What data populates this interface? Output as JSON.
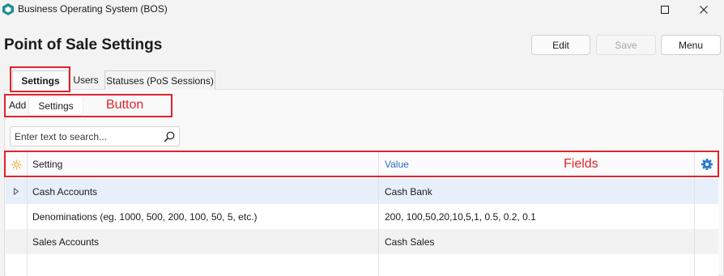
{
  "window": {
    "title": "Business Operating System (BOS)"
  },
  "page": {
    "title": "Point of Sale Settings"
  },
  "header_buttons": {
    "edit": "Edit",
    "save": "Save",
    "menu": "Menu"
  },
  "tabs": [
    {
      "label": "Settings"
    },
    {
      "label": "Users"
    },
    {
      "label": "Statuses (PoS Sessions)"
    }
  ],
  "toolbar": {
    "add_label": "Add",
    "settings_button": "Settings"
  },
  "annotations": {
    "button": "Button",
    "fields": "Fields"
  },
  "search": {
    "placeholder": "Enter text to search..."
  },
  "grid": {
    "columns": {
      "setting": "Setting",
      "value": "Value"
    },
    "rows": [
      {
        "setting": "Cash Accounts",
        "value": "Cash Bank"
      },
      {
        "setting": "Denominations (eg. 1000, 500, 200, 100, 50, 5, etc.)",
        "value": "200, 100,50,20,10,5,1, 0.5, 0.2, 0.1"
      },
      {
        "setting": "Sales Accounts",
        "value": "Cash Sales"
      }
    ]
  },
  "colors": {
    "accent": "#2b7bd0",
    "annotation": "#e0242f",
    "selected_row": "#e7f0fa",
    "sun_icon": "#f0a020"
  }
}
